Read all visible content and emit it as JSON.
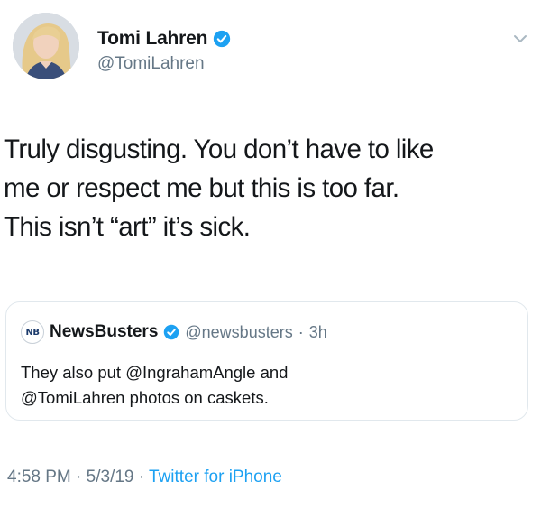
{
  "author": {
    "display_name": "Tomi Lahren",
    "handle": "@TomiLahren",
    "verified": true
  },
  "tweet": {
    "text": "Truly disgusting. You don’t have to like\nme or respect me but this is too far.\nThis isn’t “art” it’s sick."
  },
  "quoted_tweet": {
    "avatar_text": "NB",
    "display_name": "NewsBusters",
    "handle": "@newsbusters",
    "separator": "·",
    "time": "3h",
    "text": "They also put @IngrahamAngle and\n@TomiLahren photos on caskets."
  },
  "meta": {
    "time": "4:58 PM",
    "separator1": " · ",
    "date": "5/3/19",
    "separator2": " · ",
    "source": "Twitter for iPhone"
  },
  "colors": {
    "verified_blue": "#1da1f2",
    "secondary_text": "#657786",
    "primary_text": "#14171a"
  },
  "icons": {
    "verified": "verified-badge-icon",
    "caret": "chevron-down-icon"
  }
}
